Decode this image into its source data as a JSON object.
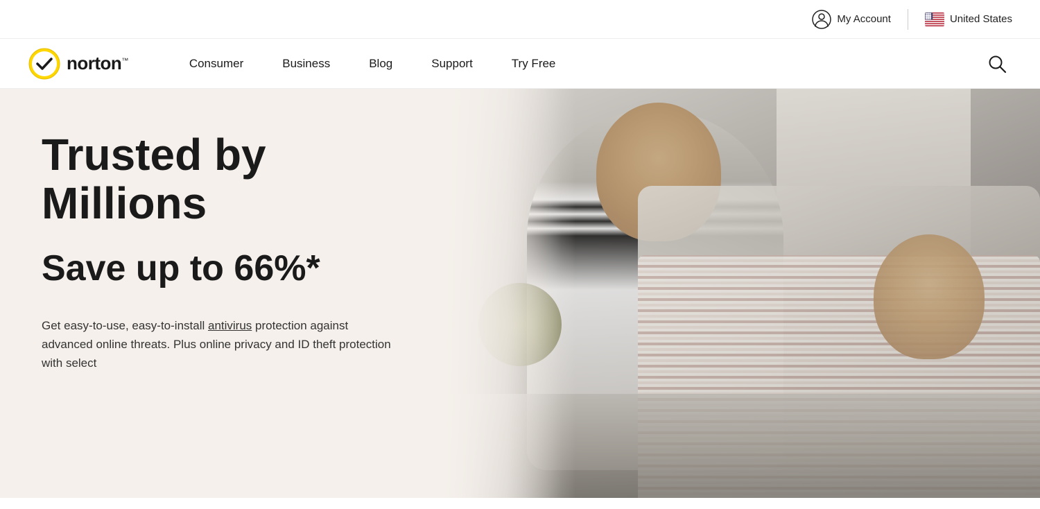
{
  "topbar": {
    "my_account_label": "My Account",
    "country_label": "United States"
  },
  "nav": {
    "logo_text": "norton",
    "logo_tm": "™",
    "links": [
      {
        "label": "Consumer"
      },
      {
        "label": "Business"
      },
      {
        "label": "Blog"
      },
      {
        "label": "Support"
      },
      {
        "label": "Try Free"
      }
    ]
  },
  "hero": {
    "title_line1": "Trusted by",
    "title_line2": "Millions",
    "subtitle": "Save up to 66%*",
    "description_part1": "Get easy-to-use, easy-to-install ",
    "description_antivirus": "antivirus",
    "description_part2": " protection against advanced online threats. Plus online privacy and ID theft protection with select"
  },
  "colors": {
    "accent_yellow": "#f5d200",
    "text_dark": "#1a1a1a",
    "hero_bg": "#f5f0eb"
  }
}
